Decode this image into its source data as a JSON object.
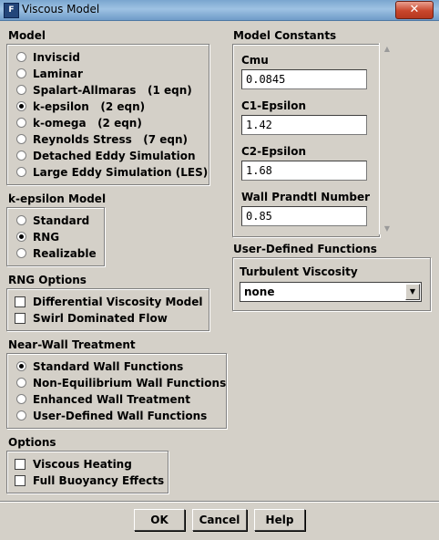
{
  "window": {
    "title": "Viscous Model",
    "close_glyph": "✕"
  },
  "model": {
    "label": "Model",
    "options": [
      {
        "label": "Inviscid",
        "selected": false
      },
      {
        "label": "Laminar",
        "selected": false
      },
      {
        "label": "Spalart-Allmaras   (1 eqn)",
        "selected": false
      },
      {
        "label": "k-epsilon   (2 eqn)",
        "selected": true
      },
      {
        "label": "k-omega   (2 eqn)",
        "selected": false
      },
      {
        "label": "Reynolds Stress   (7 eqn)",
        "selected": false
      },
      {
        "label": "Detached Eddy Simulation",
        "selected": false
      },
      {
        "label": "Large Eddy Simulation (LES)",
        "selected": false
      }
    ]
  },
  "kepsilon": {
    "label": "k-epsilon Model",
    "options": [
      {
        "label": "Standard",
        "selected": false
      },
      {
        "label": "RNG",
        "selected": true
      },
      {
        "label": "Realizable",
        "selected": false
      }
    ]
  },
  "rng": {
    "label": "RNG Options",
    "options": [
      {
        "label": "Differential Viscosity Model",
        "checked": false
      },
      {
        "label": "Swirl Dominated Flow",
        "checked": false
      }
    ]
  },
  "nearwall": {
    "label": "Near-Wall Treatment",
    "options": [
      {
        "label": "Standard Wall Functions",
        "selected": true
      },
      {
        "label": "Non-Equilibrium Wall Functions",
        "selected": false
      },
      {
        "label": "Enhanced Wall Treatment",
        "selected": false
      },
      {
        "label": "User-Defined Wall Functions",
        "selected": false
      }
    ]
  },
  "options": {
    "label": "Options",
    "items": [
      {
        "label": "Viscous Heating",
        "checked": false
      },
      {
        "label": "Full Buoyancy Effects",
        "checked": false
      }
    ]
  },
  "constants": {
    "label": "Model Constants",
    "items": [
      {
        "label": "Cmu",
        "value": "0.0845"
      },
      {
        "label": "C1-Epsilon",
        "value": "1.42"
      },
      {
        "label": "C2-Epsilon",
        "value": "1.68"
      },
      {
        "label": "Wall Prandtl Number",
        "value": "0.85"
      }
    ]
  },
  "udf": {
    "label": "User-Defined Functions",
    "turbulent_viscosity_label": "Turbulent Viscosity",
    "turbulent_viscosity_value": "none"
  },
  "buttons": {
    "ok": "OK",
    "cancel": "Cancel",
    "help": "Help"
  }
}
